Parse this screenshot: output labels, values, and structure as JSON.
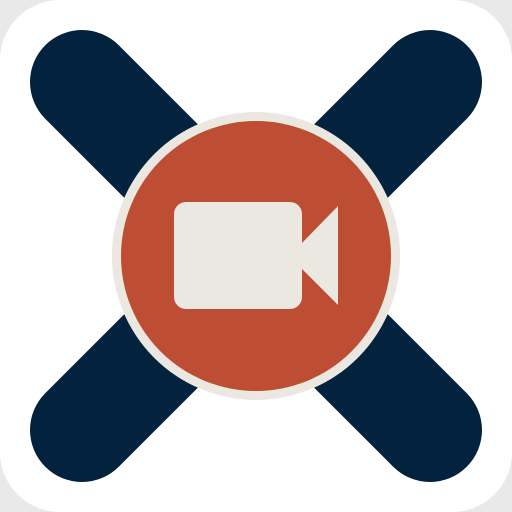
{
  "app_icon": {
    "icon": "video-camera-icon",
    "colors": {
      "tile_background": "#ffffff",
      "page_background": "#e9e9e9",
      "cross": "#02223d",
      "circle_fill": "#bd4d33",
      "circle_ring": "#ebe8e2",
      "camera": "#ebe8e2"
    }
  }
}
